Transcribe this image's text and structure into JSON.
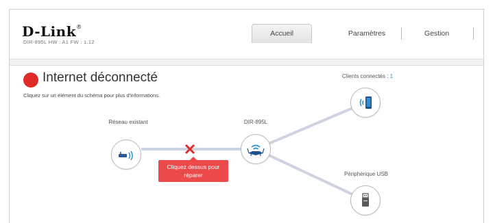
{
  "header": {
    "logo": "D-Link",
    "logo_mark": "®",
    "model_info": "DIR-895L   HW : A1   FW : 1.12"
  },
  "tabs": {
    "home": "Accueil",
    "settings": "Paramètres",
    "management": "Gestion"
  },
  "status": {
    "title": "Internet déconnecté",
    "subtitle": "Cliquez sur un élément du schéma pour plus d'informations.",
    "color": "#e02b2b"
  },
  "diagram": {
    "existing_network_label": "Réseau existant",
    "router_label": "DIR-895L",
    "clients_label": "Clients connectés : ",
    "clients_count": "1",
    "usb_label": "Périphérique USB",
    "error_tooltip": "Cliquez dessus pour réparer",
    "error_color": "#ec4a4a",
    "link_color": "#cdd3e0"
  }
}
